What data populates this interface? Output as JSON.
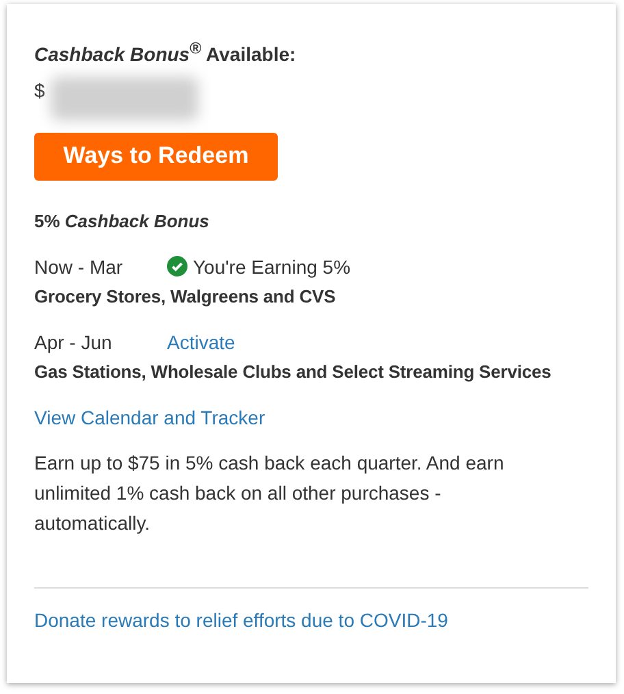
{
  "header": {
    "label": "*Cashback Bonus*$^{®}$ Available:"
  },
  "balance": {
    "currency": "$",
    "redacted": true
  },
  "redeem_button": {
    "label": "Ways to Redeem"
  },
  "bonus_title": "5% *Cashback Bonus*",
  "quarters": [
    {
      "period": "Now - Mar",
      "kind": "earning",
      "status": "You're Earning 5%",
      "categories": "Grocery Stores, Walgreens and CVS"
    },
    {
      "period": "Apr - Jun",
      "kind": "activate",
      "status": "Activate",
      "categories": "Gas Stations, Wholesale Clubs and Select Streaming Services"
    }
  ],
  "calendar_link": "View Calendar and Tracker",
  "description": "Earn up to $75 in 5% cash back each quarter. And earn unlimited 1% cash back on all other purchases - automatically.",
  "footer_link": "Donate rewards to relief efforts due to COVID-19"
}
